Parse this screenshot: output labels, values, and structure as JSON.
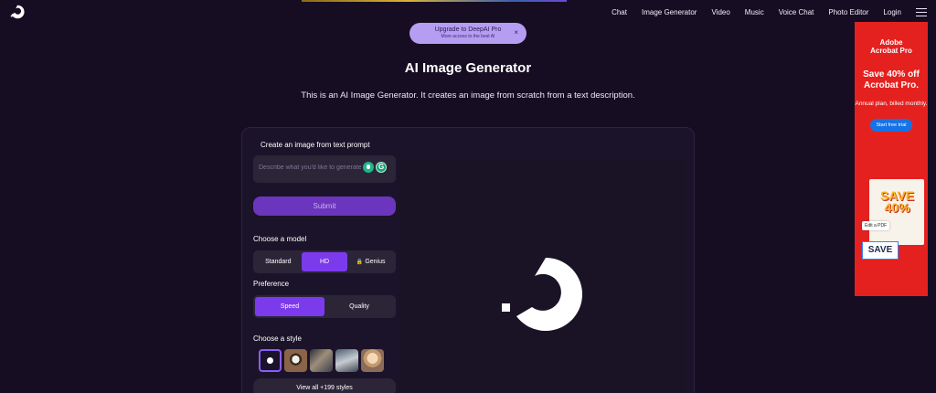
{
  "nav": {
    "items": [
      "Chat",
      "Image Generator",
      "Video",
      "Music",
      "Voice Chat",
      "Photo Editor",
      "Login"
    ]
  },
  "upgrade": {
    "title": "Upgrade to DeepAI Pro",
    "subtitle": "More access to the best AI",
    "close": "×"
  },
  "page": {
    "title": "AI Image Generator",
    "description": "This is an AI Image Generator. It creates an image from scratch from a text description."
  },
  "prompt": {
    "label": "Create an image from text prompt",
    "placeholder": "Describe what you'd like to generate",
    "submit_label": "Submit"
  },
  "model": {
    "label": "Choose a model",
    "options": [
      "Standard",
      "HD",
      "Genius"
    ],
    "selected": "HD"
  },
  "preference": {
    "label": "Preference",
    "options": [
      "Speed",
      "Quality"
    ],
    "selected": "Speed"
  },
  "style": {
    "label": "Choose a style",
    "view_all_label": "View all +199 styles"
  },
  "ad": {
    "brand_line1": "Adobe",
    "brand_line2": "Acrobat Pro",
    "headline": "Save 40% off Acrobat Pro.",
    "sub": "Annual plan, billed monthly.",
    "cta": "Start free trial",
    "art_save40_1": "SAVE",
    "art_save40_2": "40%",
    "art_editpdf": "Edit a PDF",
    "art_save": "SAVE"
  },
  "colors": {
    "background": "#160d22",
    "accent": "#7c3aed",
    "submit": "#6c35bd",
    "ad_red": "#e5211f"
  }
}
